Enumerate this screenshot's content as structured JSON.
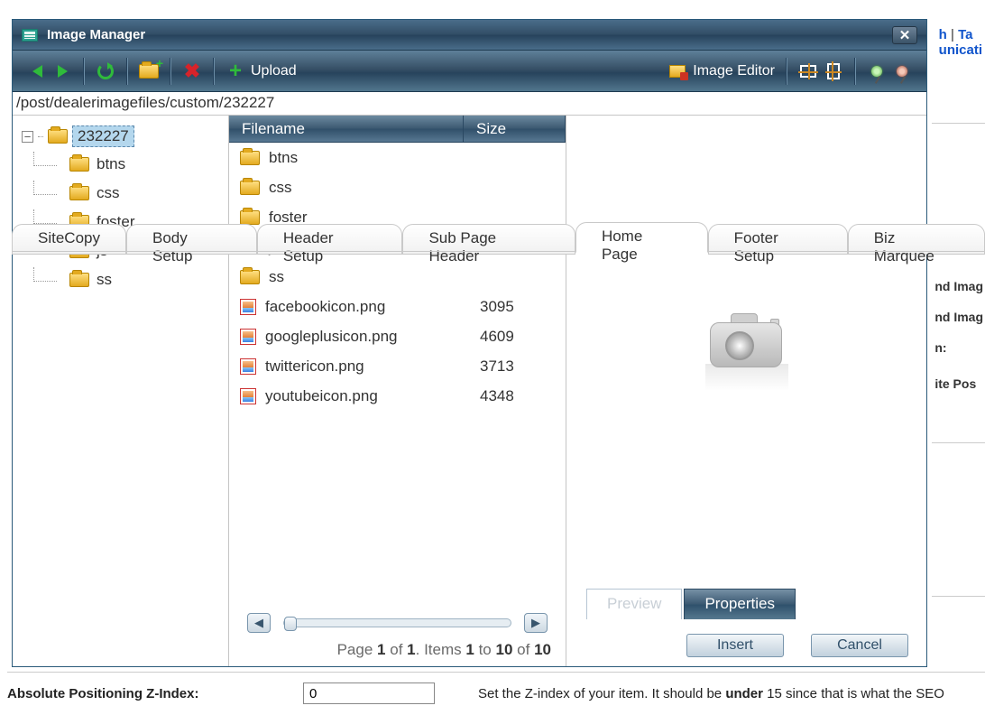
{
  "dialog": {
    "title": "Image Manager",
    "path": "/post/dealerimagefiles/custom/232227",
    "toolbar": {
      "upload_label": "Upload",
      "editor_label": "Image Editor"
    },
    "tree": {
      "root": "232227",
      "children": [
        "btns",
        "css",
        "foster",
        "js",
        "ss"
      ]
    },
    "file_headers": {
      "name": "Filename",
      "size": "Size"
    },
    "files": [
      {
        "type": "folder",
        "name": "btns",
        "size": ""
      },
      {
        "type": "folder",
        "name": "css",
        "size": ""
      },
      {
        "type": "folder",
        "name": "foster",
        "size": ""
      },
      {
        "type": "folder",
        "name": "js",
        "size": ""
      },
      {
        "type": "folder",
        "name": "ss",
        "size": ""
      },
      {
        "type": "image",
        "name": "facebookicon.png",
        "size": "3095"
      },
      {
        "type": "image",
        "name": "googleplusicon.png",
        "size": "4609"
      },
      {
        "type": "image",
        "name": "twittericon.png",
        "size": "3713"
      },
      {
        "type": "image",
        "name": "youtubeicon.png",
        "size": "4348"
      }
    ],
    "paging": {
      "page": "1",
      "pages": "1",
      "from": "1",
      "to": "10",
      "total": "10",
      "t_page": "Page",
      "t_of": "of",
      "t_items": "Items",
      "t_to": "to",
      "t_of2": "of"
    },
    "preview_tabs": {
      "preview": "Preview",
      "properties": "Properties"
    },
    "buttons": {
      "insert": "Insert",
      "cancel": "Cancel"
    }
  },
  "page_tabs": [
    "SiteCopy",
    "Body Setup",
    "Header Setup",
    "Sub Page Header",
    "Home Page",
    "Footer Setup",
    "Biz Marquee"
  ],
  "page_tabs_current": 4,
  "bg_links": {
    "a": "h",
    "sep": "|",
    "b": "Ta",
    "c": "unicati"
  },
  "bg_side": [
    "nd Imag",
    "nd Imag",
    "n:",
    "ite Pos"
  ],
  "bottom": {
    "label": "Absolute Positioning Z-Index:",
    "value": "0",
    "help_pre": "Set the Z-index of your item. It should be ",
    "help_bold": "under",
    "help_post": " 15 since that is what the SEO"
  }
}
